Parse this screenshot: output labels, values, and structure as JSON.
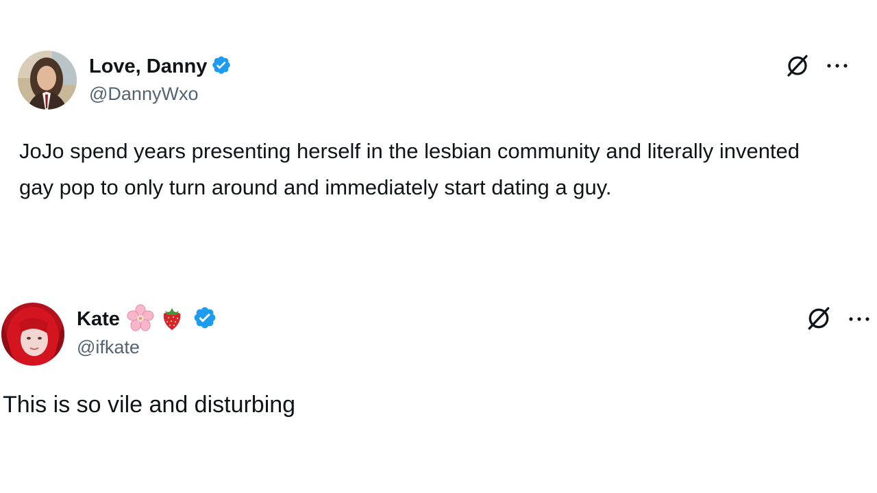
{
  "tweets": [
    {
      "display_name": "Love, Danny",
      "handle": "@DannyWxo",
      "verified": true,
      "text": "JoJo spend years presenting herself in the lesbian community and literally invented gay pop to only turn around and immediately start dating a guy.",
      "emojis": []
    },
    {
      "display_name": "Kate",
      "handle": "@ifkate",
      "verified": true,
      "text": "This is so vile and disturbing",
      "emojis": [
        "cherry-blossom-icon",
        "strawberry-icon"
      ]
    }
  ],
  "colors": {
    "text": "#0f1419",
    "secondary": "#536471",
    "verified": "#1d9bf0"
  },
  "icons": [
    "grok-icon",
    "more-icon",
    "verified-badge-icon"
  ]
}
